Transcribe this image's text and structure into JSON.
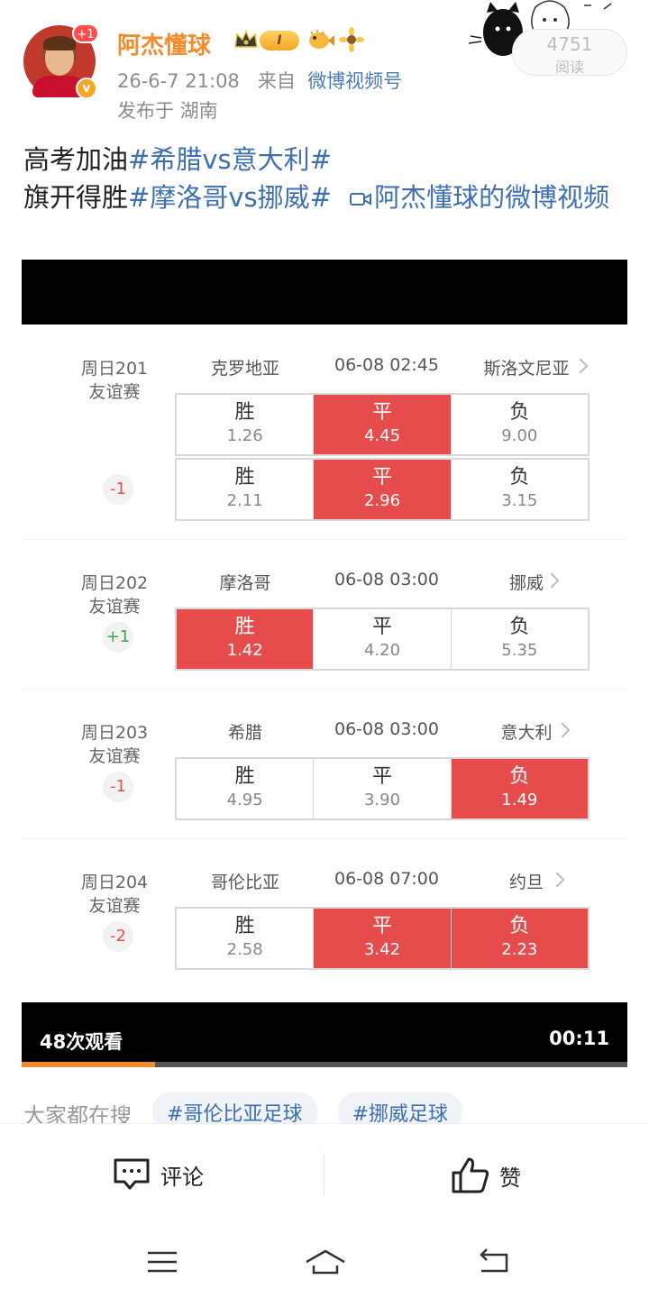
{
  "header": {
    "username": "阿杰懂球",
    "level": "I",
    "avatar_badge": "+1",
    "verified_badge": "v",
    "time": "26-6-7 21:08",
    "from_label": "来自",
    "source": "微博视频号",
    "location": "发布于 湖南",
    "read_count": "4751",
    "read_label": "阅读"
  },
  "post": {
    "line1_text": "高考加油",
    "line1_tag": "#希腊vs意大利#",
    "line2_text": "旗开得胜",
    "line2_tag": "#摩洛哥vs挪威#",
    "video_link": "阿杰懂球的微博视频"
  },
  "matches": [
    {
      "week": "周日201",
      "type": "友谊赛",
      "handicap": "-1",
      "home": "克罗地亚",
      "time": "06-08 02:45",
      "away": "斯洛文尼亚",
      "rows": [
        [
          {
            "label": "胜",
            "odd": "1.26",
            "selected": false
          },
          {
            "label": "平",
            "odd": "4.45",
            "selected": true
          },
          {
            "label": "负",
            "odd": "9.00",
            "selected": false
          }
        ],
        [
          {
            "label": "胜",
            "odd": "2.11",
            "selected": false
          },
          {
            "label": "平",
            "odd": "2.96",
            "selected": true
          },
          {
            "label": "负",
            "odd": "3.15",
            "selected": false
          }
        ]
      ]
    },
    {
      "week": "周日202",
      "type": "友谊赛",
      "handicap": "+1",
      "home": "摩洛哥",
      "time": "06-08 03:00",
      "away": "挪威",
      "rows": [
        [
          {
            "label": "胜",
            "odd": "1.42",
            "selected": true
          },
          {
            "label": "平",
            "odd": "4.20",
            "selected": false
          },
          {
            "label": "负",
            "odd": "5.35",
            "selected": false
          }
        ]
      ]
    },
    {
      "week": "周日203",
      "type": "友谊赛",
      "handicap": "-1",
      "home": "希腊",
      "time": "06-08 03:00",
      "away": "意大利",
      "rows": [
        [
          {
            "label": "胜",
            "odd": "4.95",
            "selected": false
          },
          {
            "label": "平",
            "odd": "3.90",
            "selected": false
          },
          {
            "label": "负",
            "odd": "1.49",
            "selected": true
          }
        ]
      ]
    },
    {
      "week": "周日204",
      "type": "友谊赛",
      "handicap": "-2",
      "home": "哥伦比亚",
      "time": "06-08 07:00",
      "away": "约旦",
      "rows": [
        [
          {
            "label": "胜",
            "odd": "2.58",
            "selected": false
          },
          {
            "label": "平",
            "odd": "3.42",
            "selected": true
          },
          {
            "label": "负",
            "odd": "2.23",
            "selected": true
          }
        ]
      ]
    }
  ],
  "video": {
    "views": "48次观看",
    "duration": "00:11",
    "progress": 0.22
  },
  "search": {
    "label": "大家都在搜",
    "chips": [
      "#哥伦比亚足球",
      "#挪威足球"
    ]
  },
  "actions": {
    "comment": "评论",
    "like": "赞"
  },
  "colors": {
    "username": "#f08c2b",
    "link": "#3d6fb3",
    "selected_cell": "#e74c4c"
  }
}
